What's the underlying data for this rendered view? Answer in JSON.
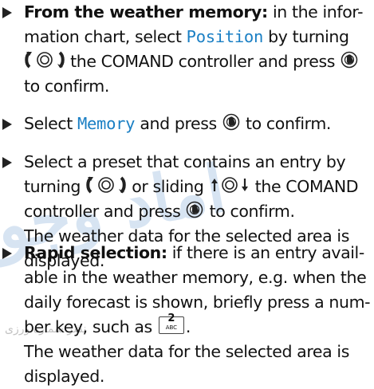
{
  "watermark": {
    "text": "اماد وجو",
    "sub": "نشر سماره ورزی"
  },
  "items": [
    {
      "lead": "From the weather memory:",
      "line1_rest": " in the infor-",
      "line2_a": "mation chart, select ",
      "line2_term": "Position",
      "line2_b": " by turning",
      "line3": " the COMAND controller and press ",
      "line4": "to confirm."
    },
    {
      "line1_a": "Select ",
      "line1_term": "Memory",
      "line1_b": " and press ",
      "line1_c": " to confirm."
    },
    {
      "line1": "Select a preset that contains an entry by",
      "line2_a": "turning ",
      "line2_b": " or sliding ",
      "line2_c": " the COMAND",
      "line3_a": "controller and press ",
      "line3_b": " to confirm.",
      "line4": "The weather data for the selected area is",
      "line5": "displayed."
    },
    {
      "lead": "Rapid selection:",
      "line1_rest": " if there is an entry avail-",
      "line2": "able in the weather memory, e.g. when the",
      "line3": "daily forecast is shown, briefly press a num-",
      "line4_a": "ber key, such as ",
      "key_number": "2",
      "key_letters": "ABC",
      "line4_b": ".",
      "line5": "The weather data for the selected area is",
      "line6": "displayed."
    }
  ],
  "icons": {
    "turn": "rotate-controller-icon",
    "slide": "slide-controller-icon",
    "press": "press-controller-icon",
    "bullet": "triangle-bullet-icon"
  }
}
